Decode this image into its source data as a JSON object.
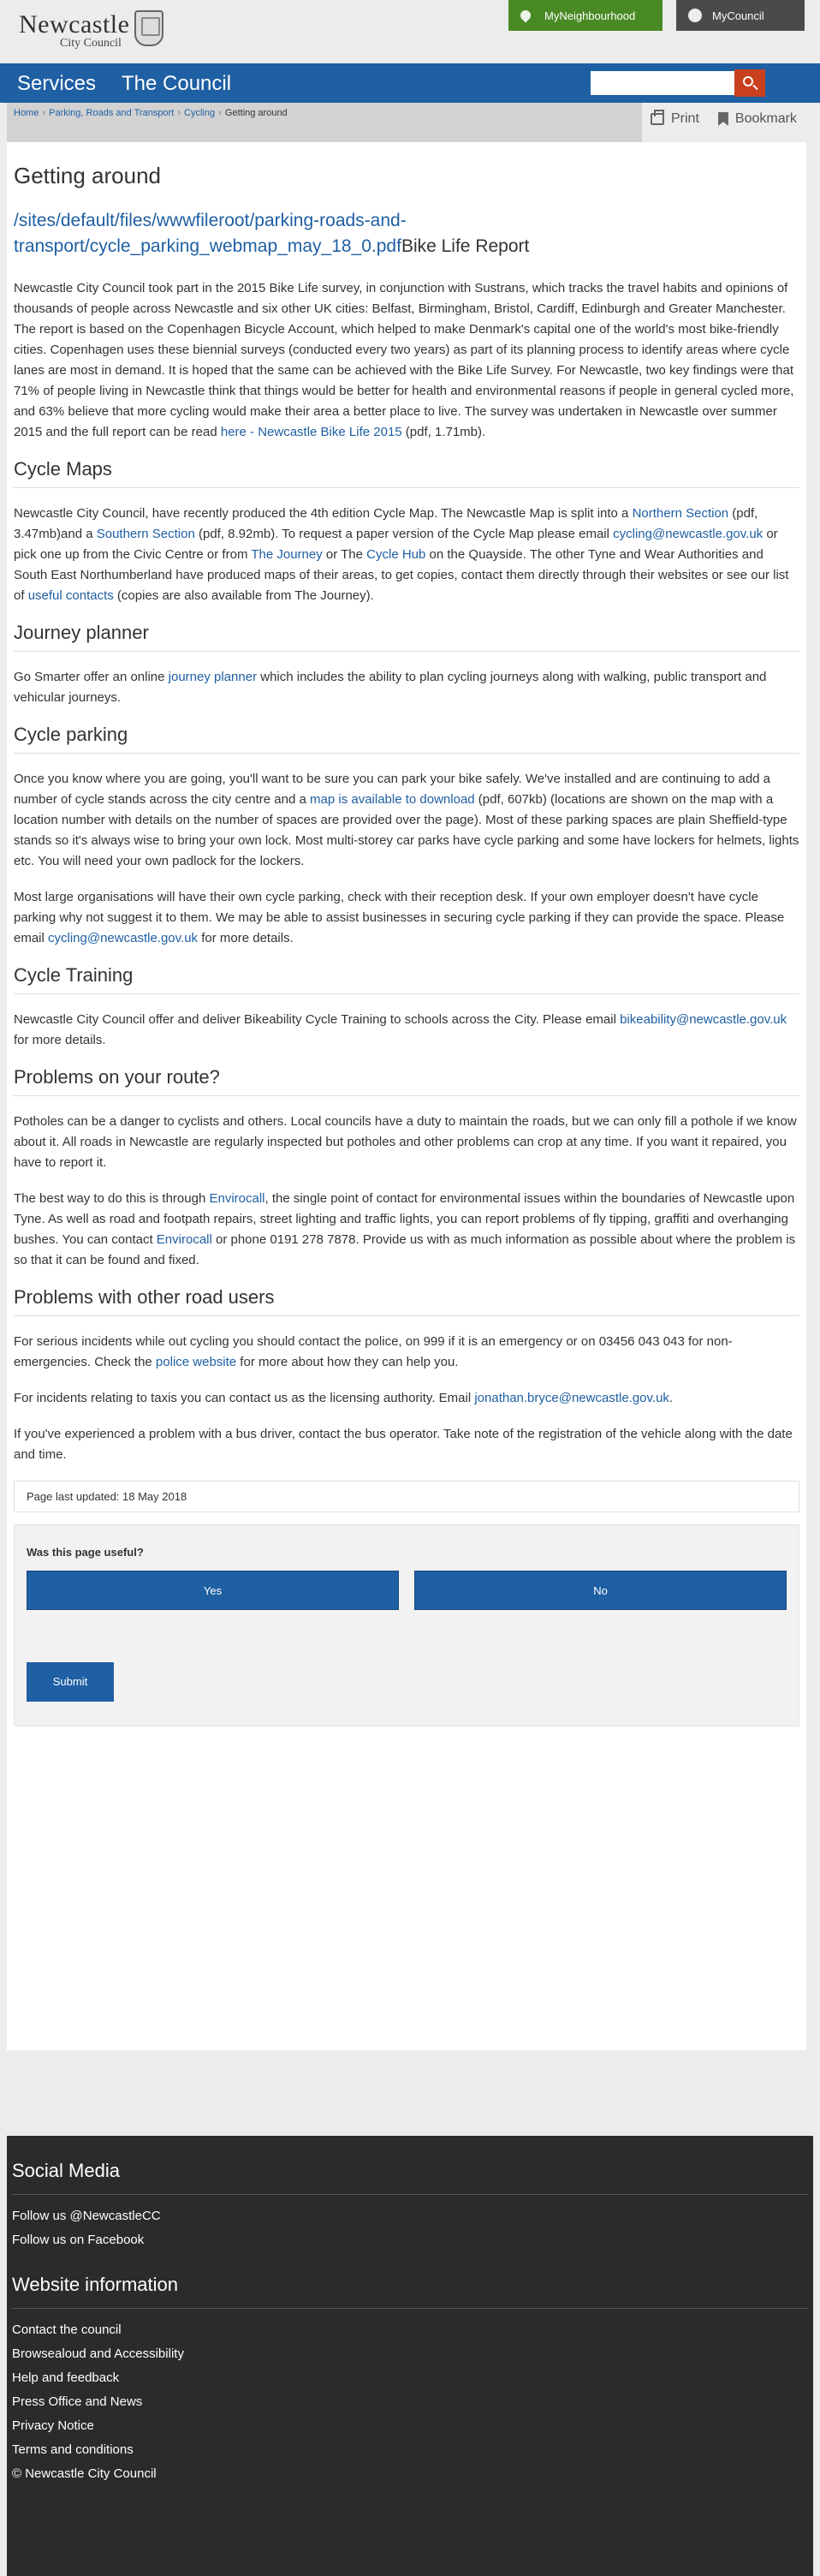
{
  "header": {
    "logo_title": "Newcastle",
    "logo_sub": "City Council",
    "my_neighbourhood": "MyNeighbourhood",
    "my_council": "MyCouncil",
    "nav": [
      "Services",
      "The Council"
    ],
    "search_placeholder": ""
  },
  "breadcrumb": [
    "Home",
    "Parking, Roads and Transport",
    "Cycling",
    "Getting around"
  ],
  "tools": {
    "print": "Print",
    "bookmark": "Bookmark"
  },
  "page": {
    "title": "Getting around",
    "pdf_link": "/sites/default/files/wwwfileroot/parking-roads-and-transport/cycle_parking_webmap_may_18_0.pdf",
    "pdf_suffix": "Bike Life Report",
    "intro": {
      "a": "Newcastle City Council took part in the 2015 Bike Life survey, in conjunction with Sustrans, which tracks the travel habits and opinions of thousands of people across Newcastle and six other UK cities: Belfast, Birmingham, Bristol, Cardiff, Edinburgh and Greater Manchester. The report is based on the Copenhagen Bicycle Account, which helped to make Denmark's capital one of the world's most bike-friendly cities. Copenhagen uses these biennial surveys (conducted every two years) as part of its planning process to identify areas where cycle lanes are most in demand. It is hoped that the same can be achieved with the Bike Life Survey. For Newcastle, two key findings were that 71% of people living in Newcastle think that things would be better for health and environmental reasons if people in general cycled more, and 63% believe that more cycling would make their area a better place to live. The survey was undertaken in Newcastle over summer 2015 and the full report can be read ",
      "link": "here - Newcastle Bike Life 2015",
      "b": " (pdf, 1.71mb)."
    },
    "cycle_maps": {
      "heading": "Cycle Maps",
      "t1": "Newcastle City Council, have recently produced the 4th edition Cycle Map. The Newcastle Map is split into a ",
      "l1": "Northern Section",
      "t2": " (pdf, 3.47mb)and a ",
      "l2": "Southern Section",
      "t3": " (pdf, 8.92mb). To request a paper version of the Cycle Map please email ",
      "l3": "cycling@newcastle.gov.uk",
      "t4": " or pick one up from the Civic Centre or from ",
      "l4": "The Journey",
      "t5": " or The ",
      "l5": "Cycle Hub",
      "t6": " on the Quayside. The other Tyne and Wear Authorities and South East Northumberland have produced maps of their areas, to get copies, contact them directly through their websites or see our list of ",
      "l6": "useful contacts",
      "t7": " (copies are also available from The Journey)."
    },
    "journey": {
      "heading": "Journey planner",
      "t1": "Go Smarter offer an online ",
      "l1": "journey planner",
      "t2": " which includes the ability to plan cycling journeys along with walking, public transport and vehicular journeys."
    },
    "parking": {
      "heading": "Cycle parking",
      "t1": "Once you know where you are going, you'll want to be sure you can park your bike safely. We've installed and are continuing to add a number of cycle stands across the city centre and a ",
      "l1": "map is available to download",
      "t2": " (pdf, 607kb) (locations are shown on the map with a location number with details on the number of spaces are provided over the page). Most of these parking spaces are plain Sheffield-type stands so it's always wise to bring your own lock. Most multi-storey car parks have cycle parking and some have lockers for helmets, lights etc. You will need your own padlock for the lockers.",
      "p2a": "Most large organisations will have their own cycle parking, check with their reception desk. If your own employer doesn't have cycle parking why not suggest it to them. We may be able to assist businesses in securing cycle parking if they can provide the space. Please email ",
      "p2l": "cycling@newcastle.gov.uk",
      "p2b": " for more details."
    },
    "training": {
      "heading": "Cycle Training",
      "t1": "Newcastle City Council offer and deliver Bikeability Cycle Training to schools across the City. Please email ",
      "l1": "bikeability@newcastle.gov.uk",
      "t2": " for more details."
    },
    "problems": {
      "heading": "Problems on your route?",
      "p1": "Potholes can be a danger to cyclists and others.  Local councils have a duty to maintain the roads, but we can only fill a pothole if we know about it. All roads in Newcastle are regularly inspected but potholes and other problems can crop at any time. If you want it repaired, you have to report it.",
      "p2a": "The best way to do this is through ",
      "p2l1": "Envirocall",
      "p2b": ", the single point of contact for environmental issues within the boundaries of Newcastle upon Tyne. As well as road and footpath repairs, street lighting and traffic lights, you can report problems of fly tipping, graffiti and overhanging bushes. You can contact ",
      "p2l2": "Envirocall",
      "p2c": " or phone 0191 278 7878. Provide us with as much information as possible about where the problem is so that it can be found and fixed."
    },
    "others": {
      "heading": "Problems with other road users",
      "p1a": "For serious incidents while out cycling you should contact the police, on 999 if it is an emergency or on 03456 043 043 for non-emergencies. Check the ",
      "p1l": "police website",
      "p1b": " for more about how they can help you.",
      "p2a": "For incidents relating to taxis you can contact us as the licensing authority. Email ",
      "p2l": "jonathan.bryce@newcastle.gov.uk",
      "p2b": ".",
      "p3": "If you've experienced a problem with a bus driver, contact the bus operator. Take note of the registration of the vehicle along with the date and time."
    },
    "last_updated": "Page last updated: 18 May 2018"
  },
  "feedback": {
    "question": "Was this page useful?",
    "yes": "Yes",
    "no": "No",
    "submit": "Submit"
  },
  "footer": {
    "social_heading": "Social Media",
    "social": [
      "Follow us @NewcastleCC",
      "Follow us on Facebook"
    ],
    "info_heading": "Website information",
    "info": [
      "Contact the council",
      "Browsealoud and Accessibility",
      "Help and feedback",
      "Press Office and News",
      "Privacy Notice",
      "Terms and conditions",
      "© Newcastle City Council"
    ]
  }
}
